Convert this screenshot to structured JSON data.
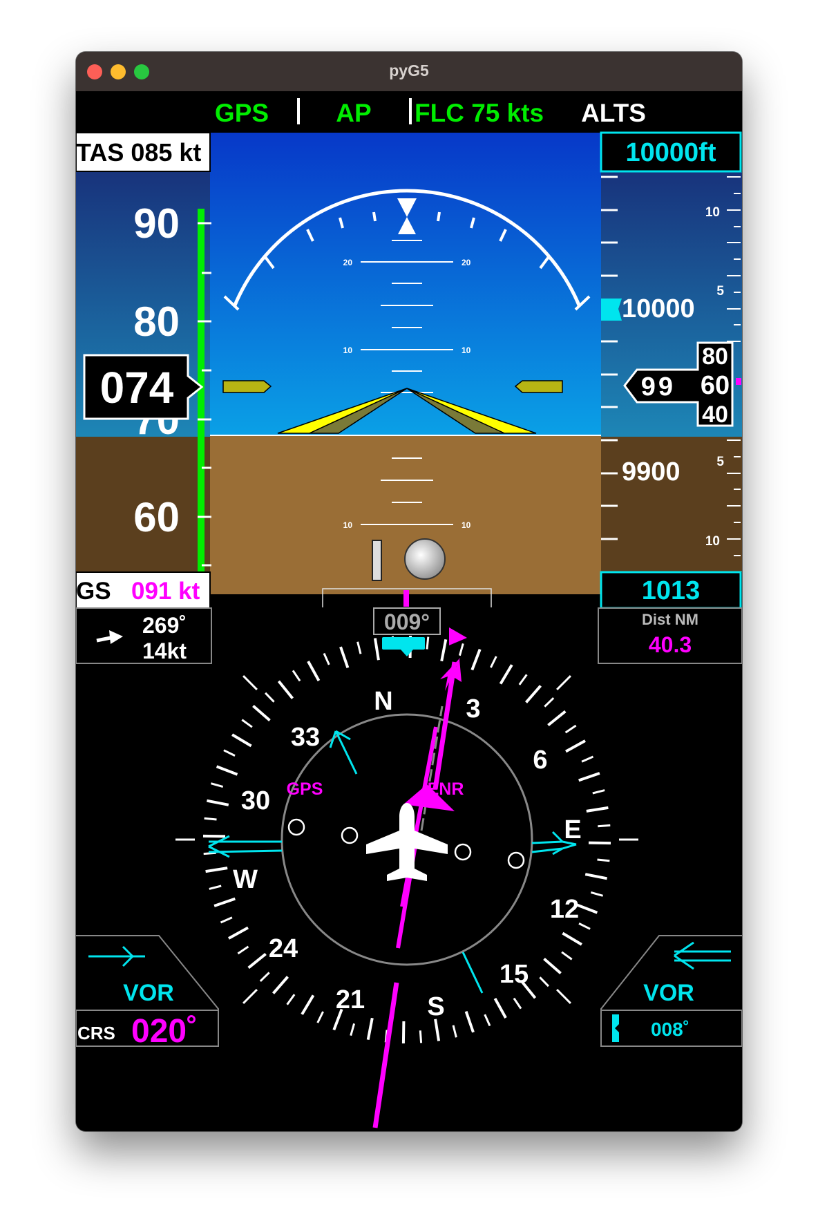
{
  "window": {
    "title": "pyG5"
  },
  "annunciator": {
    "lateral": "GPS",
    "ap": "AP",
    "vertical": "FLC 75 kts",
    "alt_mode": "ALTS"
  },
  "airspeed": {
    "tas_label": "TAS 085 kt",
    "current": "074",
    "ticks": [
      "90",
      "80",
      "70",
      "60"
    ],
    "gs_label": "GS",
    "gs_value": "091 kt"
  },
  "attitude": {
    "pitch_labels": [
      "20",
      "20",
      "10",
      "10",
      "10",
      "10"
    ]
  },
  "altitude": {
    "selected": "10000ft",
    "tick_10000": "10000",
    "tick_9900": "9900",
    "minor_labels": [
      "10",
      "5",
      "5",
      "10"
    ],
    "drum_hundreds": "99",
    "drum_upper": "80",
    "drum_current": "60",
    "drum_lower": "40",
    "baro": "1013"
  },
  "hsi": {
    "heading": "009°",
    "wind_dir": "269˚",
    "wind_speed": "14kt",
    "dist_label": "Dist NM",
    "dist_value": "40.3",
    "nav_source": "GPS",
    "phase": "ENR",
    "compass_labels": [
      "N",
      "3",
      "6",
      "E",
      "12",
      "15",
      "S",
      "21",
      "24",
      "W",
      "30",
      "33"
    ],
    "left_bearing_label": "VOR",
    "right_bearing_label": "VOR",
    "crs_label": "CRS",
    "crs_value": "020˚",
    "right_bearing_value": "008˚"
  },
  "colors": {
    "sky_top": "#0738c8",
    "sky_bottom": "#0aa0e6",
    "ground": "#9a6e36",
    "magenta": "#ff00ff",
    "cyan": "#00e5ee",
    "green": "#00ee00"
  }
}
